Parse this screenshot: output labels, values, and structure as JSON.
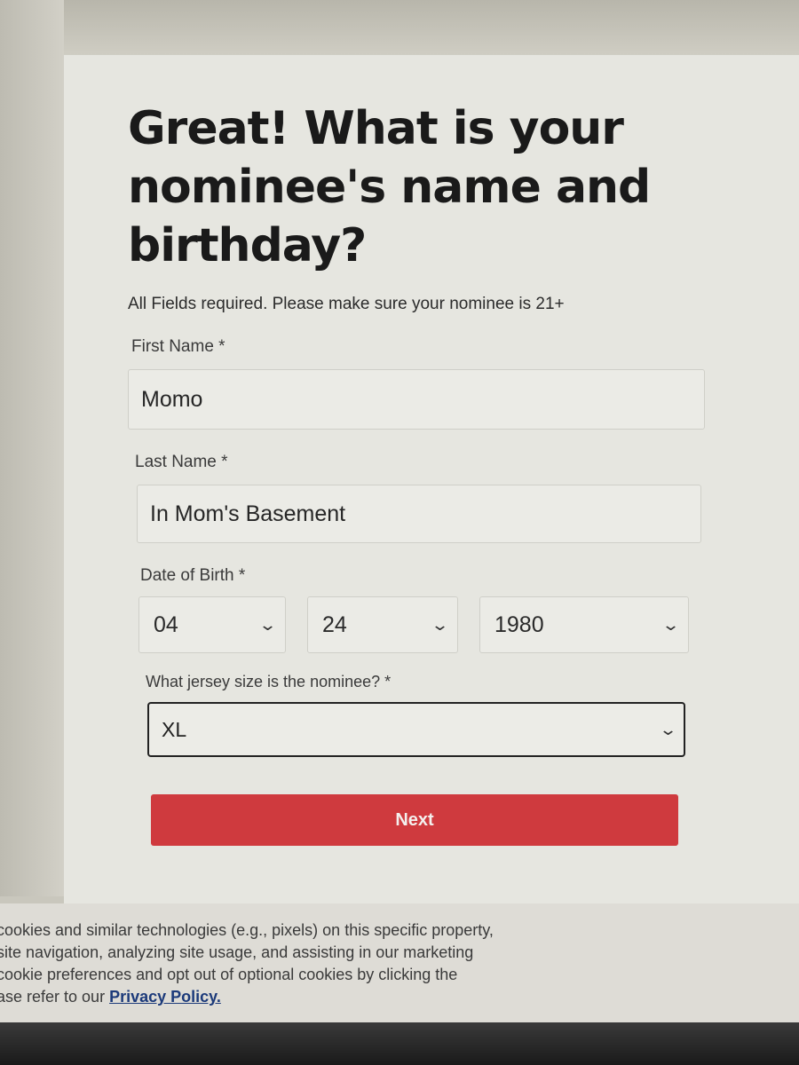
{
  "form": {
    "heading": "Great! What is your nominee's name and birthday?",
    "subtext": "All Fields required. Please make sure your nominee is 21+",
    "first_name": {
      "label": "First Name  *",
      "value": "Momo"
    },
    "last_name": {
      "label": "Last Name *",
      "value": "In Mom's Basement"
    },
    "dob": {
      "label": "Date of Birth  *",
      "month": "04",
      "day": "24",
      "year": "1980"
    },
    "jersey": {
      "label": "What jersey size is the nominee? *",
      "value": "XL"
    },
    "next_label": "Next"
  },
  "cookie": {
    "line1": "cookies and similar technologies (e.g., pixels) on this specific property,",
    "line2": "site navigation, analyzing site usage, and assisting in our marketing",
    "line3": "cookie preferences and opt out of optional cookies by clicking the",
    "line4_prefix": "ase refer to our ",
    "link": "Privacy Policy."
  },
  "colors": {
    "button": "#cf3a3e",
    "link": "#1c3a7a"
  }
}
